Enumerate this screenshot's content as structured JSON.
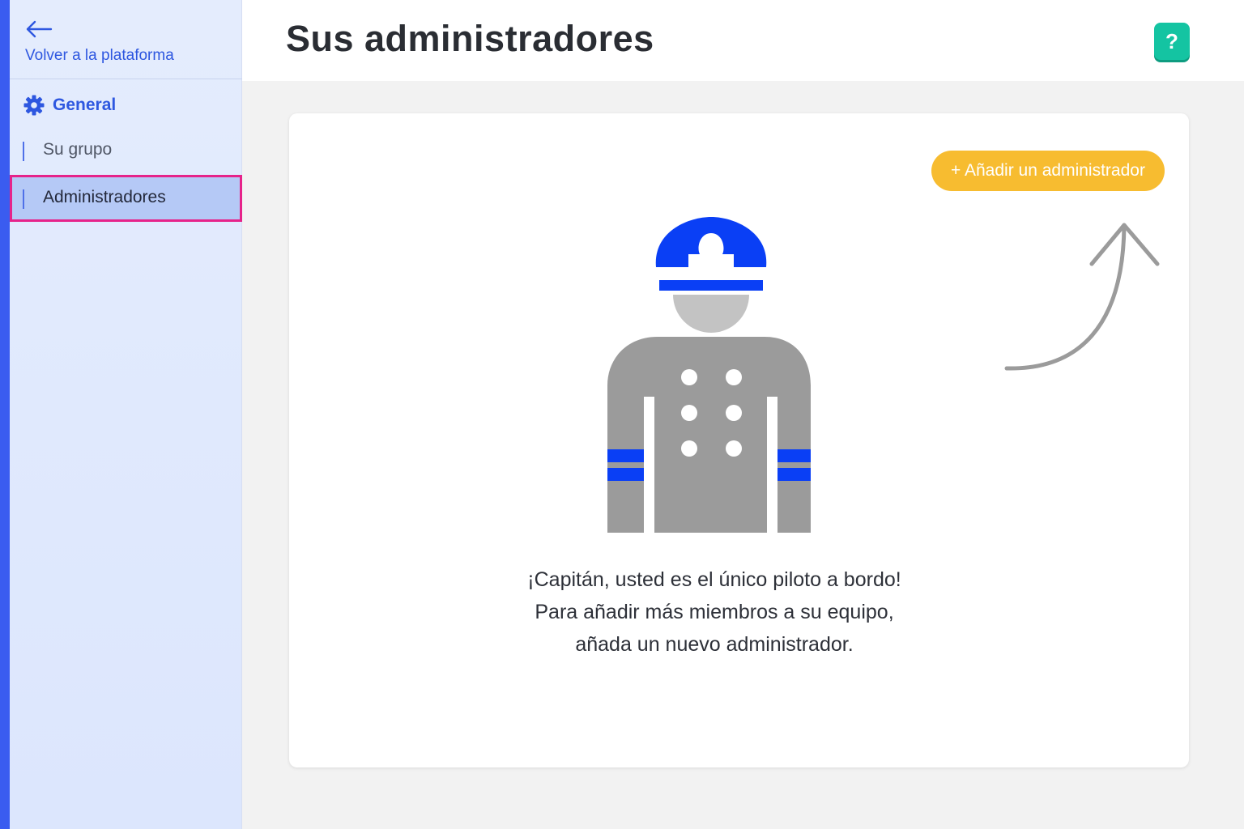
{
  "colors": {
    "accent": "#2e57e0",
    "sidebar_bg": "#e4ecfd",
    "active_item_bg": "#b5c9f6",
    "highlight_outline": "#e6238a",
    "help_button": "#14c4a2",
    "add_button": "#f7bc30",
    "captain_blue": "#0a3ff5",
    "captain_gray": "#9b9b9b"
  },
  "sidebar": {
    "back_icon": "arrow-left-icon",
    "back_label": "Volver a la plataforma",
    "section": {
      "icon": "gear-icon",
      "label": "General"
    },
    "items": [
      {
        "label": "Su grupo",
        "active": false
      },
      {
        "label": "Administradores",
        "active": true
      }
    ]
  },
  "header": {
    "title": "Sus administradores",
    "help_icon": "question-mark-icon",
    "help_label": "?"
  },
  "main": {
    "add_button_label": "+ Añadir un administrador",
    "illustration": "captain-icon",
    "hint_icon": "curved-arrow-icon",
    "message_lines": [
      "¡Capitán, usted es el único piloto a bordo!",
      "Para añadir más miembros a su equipo,",
      "añada un nuevo administrador."
    ]
  }
}
